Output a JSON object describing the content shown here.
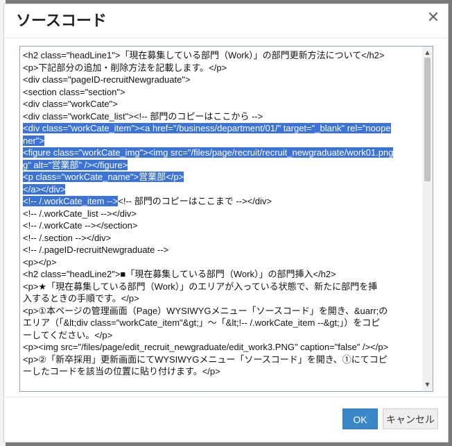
{
  "dialog": {
    "title": "ソースコード",
    "close_icon": "close-icon",
    "ok_label": "OK",
    "cancel_label": "キャンセル"
  },
  "colors": {
    "selection": "#3b73d6",
    "ok_button": "#3c87c8",
    "editor_border": "#8aa3c2"
  },
  "code_lines": [
    {
      "text": "<h2 class=\"headLine1\">「現在募集している部門（Work）」の部門更新方法について</h2>",
      "selected": false
    },
    {
      "text": "<p>下記部分の追加・削除方法を記載します。</p>",
      "selected": false
    },
    {
      "text": "<div class=\"pageID-recruitNewgraduate\">",
      "selected": false
    },
    {
      "text": "<section class=\"section\">",
      "selected": false
    },
    {
      "text": "<div class=\"workCate\">",
      "selected": false
    },
    {
      "text": "<div class=\"workCate_list\"><!-- 部門のコピーはここから -->",
      "selected": false
    },
    {
      "text": "<div class=\"workCate_item\"><a href=\"/business/department/01/\" target=\"_blank\" rel=\"noope",
      "selected": true
    },
    {
      "text": "ner\">",
      "selected": true
    },
    {
      "text": "<figure class=\"workCate_img\"><img src=\"/files/page/recruit/recruit_newgraduate/work01.png",
      "selected": true
    },
    {
      "text": "g\" alt=\"営業部\" /></figure>",
      "selected": true
    },
    {
      "text": "<p class=\"workCate_name\">営業部</p>",
      "selected": true
    },
    {
      "text": "</a></div>",
      "selected": true
    },
    {
      "text": "<!-- /.workCate_item -->",
      "selected": true,
      "suffix": "<!-- 部門のコピーはここまで --></div>"
    },
    {
      "text": "<!-- /.workCate_list --></div>",
      "selected": false
    },
    {
      "text": "<!-- /.workCate --></section>",
      "selected": false
    },
    {
      "text": "<!-- /.section --></div>",
      "selected": false
    },
    {
      "text": "<!-- /.pageID-recruitNewgraduate -->",
      "selected": false
    },
    {
      "text": "<p></p>",
      "selected": false
    },
    {
      "text": "<h2 class=\"headLine2\">■「現在募集している部門（Work）」の部門挿入</h2>",
      "selected": false
    },
    {
      "text": "<p>★「現在募集している部門（Work）」のエリアが入っている状態で、新たに部門を挿",
      "selected": false
    },
    {
      "text": "入するときの手順です。</p>",
      "selected": false
    },
    {
      "text": "<p>①本ページの管理画面（Page）WYSIWYGメニュー「ソースコード」を開き、&uarr;の",
      "selected": false
    },
    {
      "text": "エリア（「&lt;div class=\"workCate_item\"&gt;」～「&lt;!-- /.workCate_item --&gt;」）をコピ",
      "selected": false
    },
    {
      "text": "ーしてください。</p>",
      "selected": false
    },
    {
      "text": "<p><img src=\"/files/page/edit_recruit_newgraduate/edit_work3.PNG\" caption=\"false\" /></p>",
      "selected": false
    },
    {
      "text": "<p>②「新卒採用」更新画面にてWYSIWYGメニュー「ソースコード」を開き、①にてコピ",
      "selected": false
    },
    {
      "text": "ーしたコードを該当の位置に貼り付けます。</p>",
      "selected": false
    }
  ]
}
